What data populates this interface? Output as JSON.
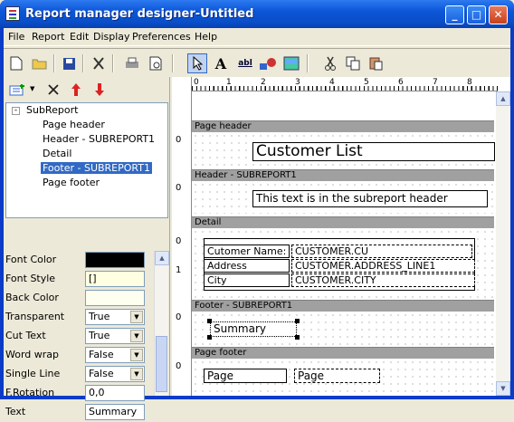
{
  "window": {
    "title": "Report manager designer-Untitled",
    "minimize": "_",
    "maximize": "□",
    "close": "✕"
  },
  "menu": [
    "File",
    "Report",
    "Edit",
    "Display",
    "Preferences",
    "Help"
  ],
  "toolbar": [
    "new-icon",
    "open-icon",
    "save-icon",
    "cut-tool-icon",
    "print-icon",
    "print-preview-icon",
    "pointer-icon",
    "label-tool-icon",
    "field-tool-icon",
    "shape-tool-icon",
    "image-tool-icon",
    "scissors-icon",
    "copy-icon",
    "paste-icon"
  ],
  "tree": {
    "root": "SubReport",
    "items": [
      "Page header",
      "Header - SUBREPORT1",
      "Detail",
      "Footer - SUBREPORT1",
      "Page footer"
    ],
    "selected": "Footer - SUBREPORT1"
  },
  "properties": [
    {
      "label": "Font Color",
      "type": "color",
      "value": "#000000"
    },
    {
      "label": "Font Style",
      "type": "text",
      "value": "[]"
    },
    {
      "label": "Back Color",
      "type": "color",
      "value": "#ffffff"
    },
    {
      "label": "Transparent",
      "type": "combo",
      "value": "True"
    },
    {
      "label": "Cut Text",
      "type": "combo",
      "value": "True"
    },
    {
      "label": "Word wrap",
      "type": "combo",
      "value": "False"
    },
    {
      "label": "Single Line",
      "type": "combo",
      "value": "False"
    },
    {
      "label": "F.Rotation",
      "type": "text",
      "value": "0,0"
    },
    {
      "label": "Text",
      "type": "text",
      "value": "Summary"
    }
  ],
  "ruler": {
    "h_ticks": [
      "0",
      "1",
      "2",
      "3",
      "4",
      "5",
      "6",
      "7",
      "8"
    ],
    "v_zero": "0",
    "v_one": "1"
  },
  "bands": {
    "page_header": {
      "title": "Page header",
      "label": "Customer List"
    },
    "sub_header": {
      "title": "Header - SUBREPORT1",
      "label": "This text is in the subreport header"
    },
    "detail": {
      "title": "Detail",
      "labels": [
        "Cutomer Name:",
        "Address",
        "City"
      ],
      "fields": [
        "CUSTOMER.CU",
        "CUSTOMER.ADDRESS_LINE1",
        "CUSTOMER.CITY"
      ]
    },
    "sub_footer": {
      "title": "Footer - SUBREPORT1",
      "label": "Summary"
    },
    "page_footer": {
      "title": "Page footer",
      "label": "Page",
      "field": "Page"
    }
  }
}
